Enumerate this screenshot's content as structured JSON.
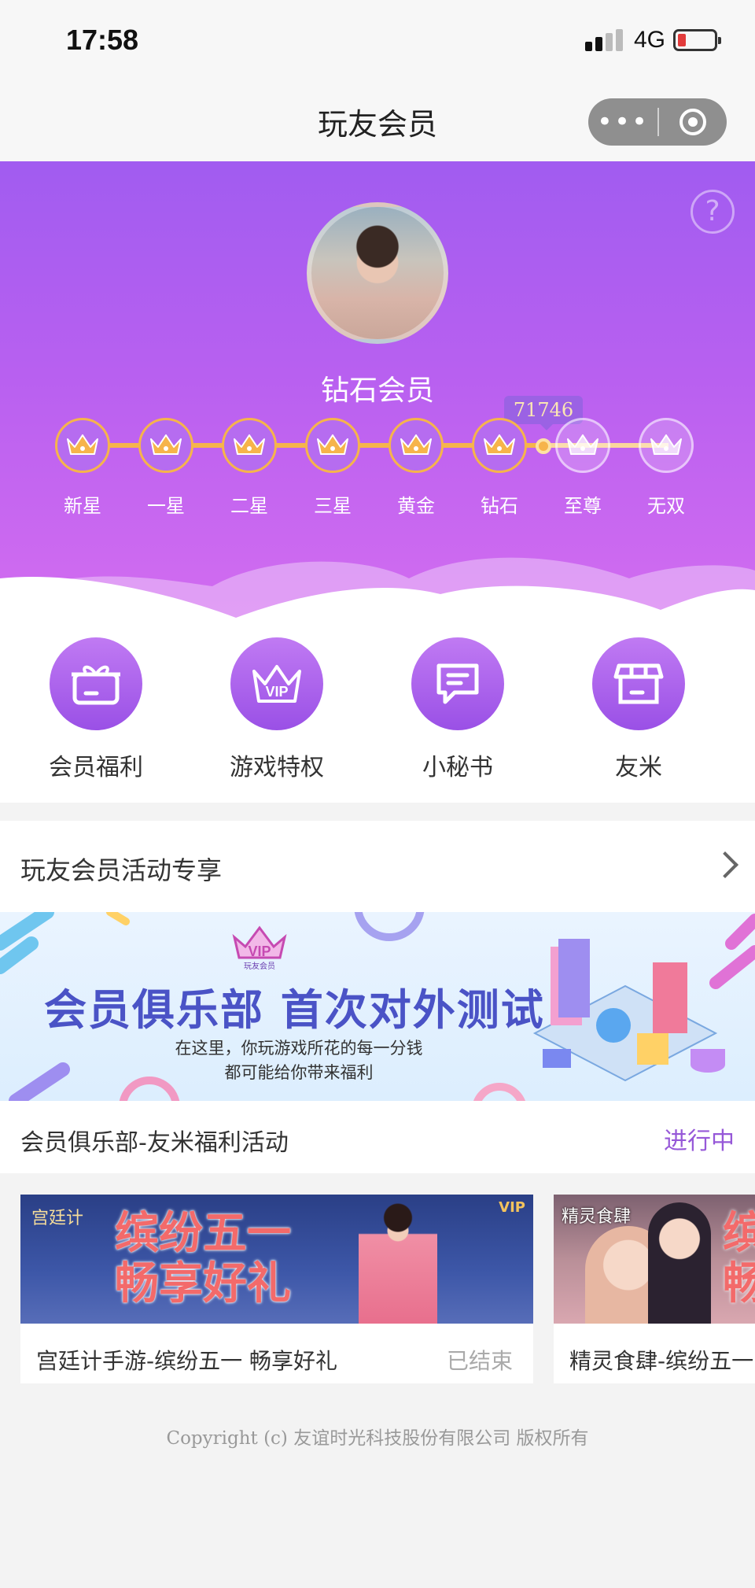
{
  "status_bar": {
    "time": "17:58",
    "network": "4G"
  },
  "nav": {
    "title": "玩友会员",
    "more_glyph": "•••"
  },
  "hero": {
    "help_glyph": "?",
    "level_name": "钻石会员",
    "points": "71746",
    "levels": [
      {
        "label": "新星",
        "achieved": true
      },
      {
        "label": "一星",
        "achieved": true
      },
      {
        "label": "二星",
        "achieved": true
      },
      {
        "label": "三星",
        "achieved": true
      },
      {
        "label": "黄金",
        "achieved": true
      },
      {
        "label": "钻石",
        "achieved": true
      },
      {
        "label": "至尊",
        "achieved": false
      },
      {
        "label": "无双",
        "achieved": false
      }
    ]
  },
  "features": [
    {
      "label": "会员福利",
      "icon": "gift-icon"
    },
    {
      "label": "游戏特权",
      "icon": "vip-crown-icon"
    },
    {
      "label": "小秘书",
      "icon": "chat-icon"
    },
    {
      "label": "友米",
      "icon": "shop-icon"
    }
  ],
  "activity_section": {
    "title": "玩友会员活动专享",
    "banner": {
      "vip_text": "VIP",
      "vip_sub": "玩友会员",
      "title": "会员俱乐部 首次对外测试",
      "subtitle_line1": "在这里，你玩游戏所花的每一分钱",
      "subtitle_line2": "都可能给你带来福利"
    },
    "activity_name": "会员俱乐部-友米福利活动",
    "activity_status": "进行中"
  },
  "cards": [
    {
      "title": "宫廷计手游-缤纷五一 畅享好礼",
      "state": "已结束",
      "banner_logo": "宫廷计",
      "banner_text_1": "缤纷五一",
      "banner_text_2": "畅享好礼",
      "banner_badge": "VIP"
    },
    {
      "title": "精灵食肆-缤纷五一",
      "banner_logo": "精灵食肆",
      "banner_text_1": "缤",
      "banner_text_2": "畅"
    }
  ],
  "footer": {
    "copyright": "Copyright (c) 友谊时光科技股份有限公司 版权所有"
  },
  "colors": {
    "accent": "#9658d8",
    "gold": "#f6b44b",
    "hero_top": "#a15cf0",
    "hero_bottom": "#d46df0"
  }
}
